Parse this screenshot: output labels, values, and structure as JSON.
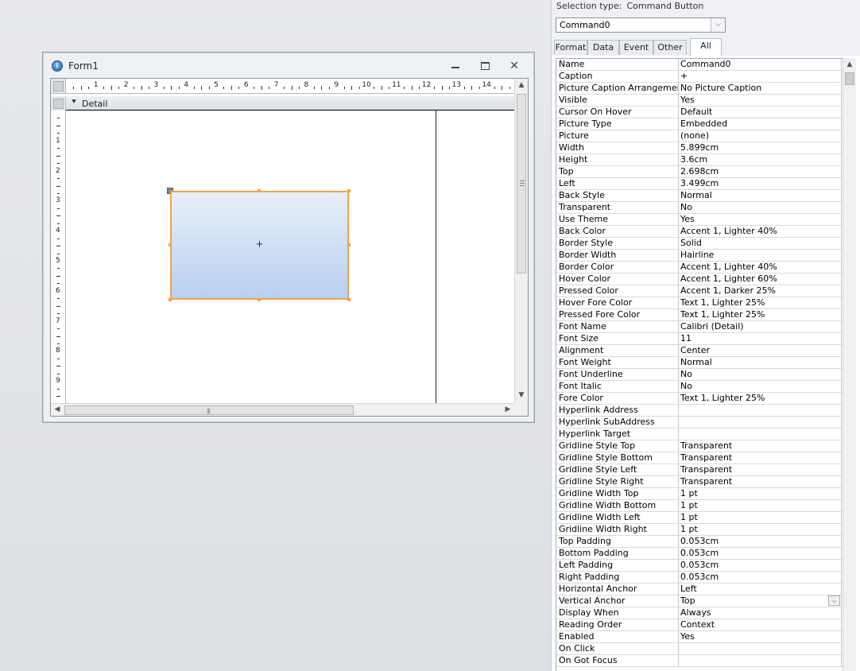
{
  "form_window": {
    "title": "Form1",
    "section_label": "Detail",
    "button_caption": "+",
    "ruler_numbers": [
      "1",
      "2",
      "3",
      "4",
      "5",
      "6",
      "7",
      "8",
      "9",
      "10",
      "11",
      "12",
      "13",
      "14"
    ],
    "vruler_numbers": [
      "1",
      "2",
      "3",
      "4",
      "5",
      "6",
      "7",
      "8",
      "9"
    ]
  },
  "property_sheet": {
    "selection_type_label": "Selection type:",
    "selection_type_value": "Command Button",
    "object_name": "Command0",
    "tabs": [
      {
        "label": "Format",
        "active": false
      },
      {
        "label": "Data",
        "active": false
      },
      {
        "label": "Event",
        "active": false
      },
      {
        "label": "Other",
        "active": false
      },
      {
        "label": "All",
        "active": true
      }
    ],
    "properties": [
      {
        "name": "Name",
        "value": "Command0"
      },
      {
        "name": "Caption",
        "value": "+"
      },
      {
        "name": "Picture Caption Arrangement",
        "value": "No Picture Caption"
      },
      {
        "name": "Visible",
        "value": "Yes"
      },
      {
        "name": "Cursor On Hover",
        "value": "Default"
      },
      {
        "name": "Picture Type",
        "value": "Embedded"
      },
      {
        "name": "Picture",
        "value": "(none)"
      },
      {
        "name": "Width",
        "value": "5.899cm"
      },
      {
        "name": "Height",
        "value": "3.6cm"
      },
      {
        "name": "Top",
        "value": "2.698cm"
      },
      {
        "name": "Left",
        "value": "3.499cm"
      },
      {
        "name": "Back Style",
        "value": "Normal"
      },
      {
        "name": "Transparent",
        "value": "No"
      },
      {
        "name": "Use Theme",
        "value": "Yes"
      },
      {
        "name": "Back Color",
        "value": "Accent 1, Lighter 40%"
      },
      {
        "name": "Border Style",
        "value": "Solid"
      },
      {
        "name": "Border Width",
        "value": "Hairline"
      },
      {
        "name": "Border Color",
        "value": "Accent 1, Lighter 40%"
      },
      {
        "name": "Hover Color",
        "value": "Accent 1, Lighter 60%"
      },
      {
        "name": "Pressed Color",
        "value": "Accent 1, Darker 25%"
      },
      {
        "name": "Hover Fore Color",
        "value": "Text 1, Lighter 25%"
      },
      {
        "name": "Pressed Fore Color",
        "value": "Text 1, Lighter 25%"
      },
      {
        "name": "Font Name",
        "value": "Calibri (Detail)"
      },
      {
        "name": "Font Size",
        "value": "11"
      },
      {
        "name": "Alignment",
        "value": "Center"
      },
      {
        "name": "Font Weight",
        "value": "Normal"
      },
      {
        "name": "Font Underline",
        "value": "No"
      },
      {
        "name": "Font Italic",
        "value": "No"
      },
      {
        "name": "Fore Color",
        "value": "Text 1, Lighter 25%"
      },
      {
        "name": "Hyperlink Address",
        "value": ""
      },
      {
        "name": "Hyperlink SubAddress",
        "value": ""
      },
      {
        "name": "Hyperlink Target",
        "value": ""
      },
      {
        "name": "Gridline Style Top",
        "value": "Transparent"
      },
      {
        "name": "Gridline Style Bottom",
        "value": "Transparent"
      },
      {
        "name": "Gridline Style Left",
        "value": "Transparent"
      },
      {
        "name": "Gridline Style Right",
        "value": "Transparent"
      },
      {
        "name": "Gridline Width Top",
        "value": "1 pt"
      },
      {
        "name": "Gridline Width Bottom",
        "value": "1 pt"
      },
      {
        "name": "Gridline Width Left",
        "value": "1 pt"
      },
      {
        "name": "Gridline Width Right",
        "value": "1 pt"
      },
      {
        "name": "Top Padding",
        "value": "0.053cm"
      },
      {
        "name": "Bottom Padding",
        "value": "0.053cm"
      },
      {
        "name": "Left Padding",
        "value": "0.053cm"
      },
      {
        "name": "Right Padding",
        "value": "0.053cm"
      },
      {
        "name": "Horizontal Anchor",
        "value": "Left"
      },
      {
        "name": "Vertical Anchor",
        "value": "Top",
        "dropdown": true
      },
      {
        "name": "Display When",
        "value": "Always"
      },
      {
        "name": "Reading Order",
        "value": "Context"
      },
      {
        "name": "Enabled",
        "value": "Yes"
      },
      {
        "name": "On Click",
        "value": ""
      },
      {
        "name": "On Got Focus",
        "value": ""
      }
    ]
  },
  "colors": {
    "selection_border": "#f5a14b",
    "button_gradient_top": "#e9eff9",
    "button_gradient_bottom": "#b9cff0"
  }
}
